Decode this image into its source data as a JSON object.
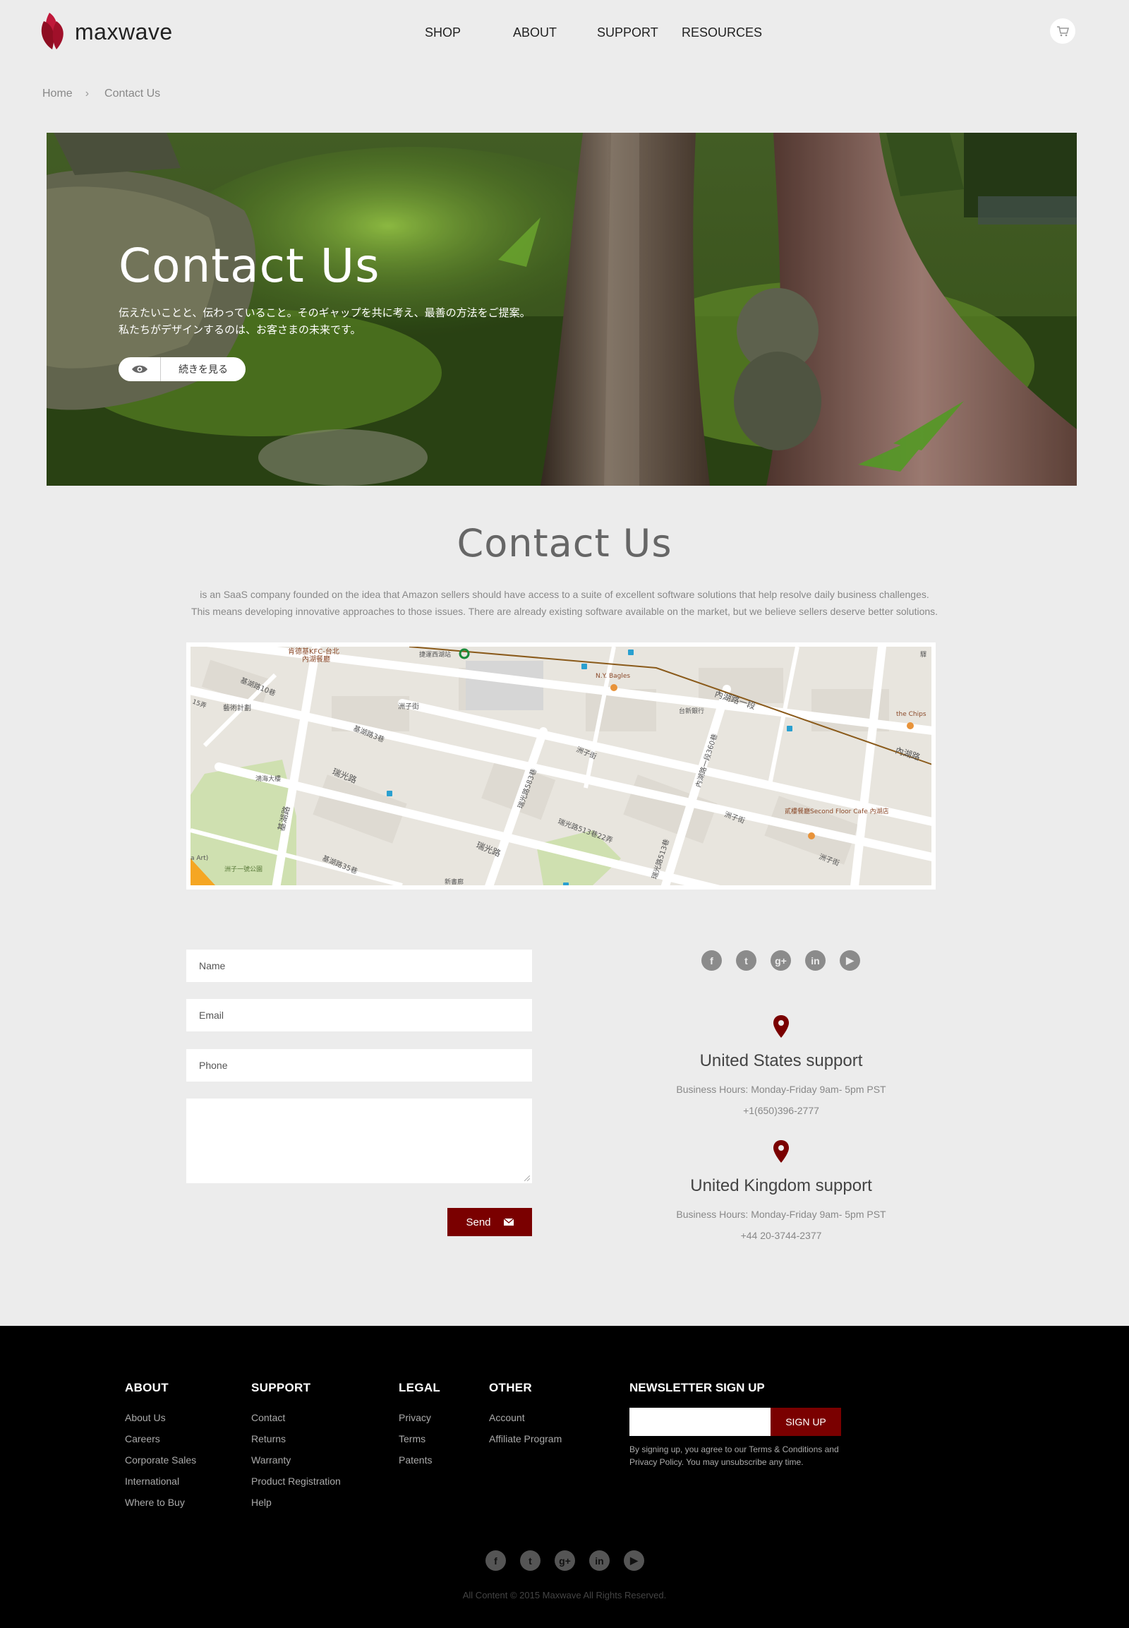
{
  "brand": {
    "name": "maxwave",
    "accent": "#7a0000"
  },
  "nav": {
    "items": [
      "SHOP",
      "ABOUT",
      "SUPPORT",
      "RESOURCES"
    ]
  },
  "header": {
    "cart_icon": "cart-icon"
  },
  "breadcrumb": {
    "items": [
      "Home",
      "Contact Us"
    ],
    "separator": "›"
  },
  "hero": {
    "title": "Contact Us",
    "description": "伝えたいことと、伝わっていること。そのギャップを共に考え、最善の方法をご提案。\n私たちがデザインするのは、お客さまの未来です。",
    "button_label": "続きを見る",
    "button_icon": "eye-icon"
  },
  "section": {
    "title": "Contact Us",
    "desc_line1": " is an SaaS company founded on the idea that Amazon sellers should have access to a suite of excellent software solutions that help resolve daily business challenges.",
    "desc_line2": "This means developing innovative approaches to those issues. There are already existing software available on the market, but we believe sellers deserve better solutions."
  },
  "map": {
    "labels": [
      "肯德基KFC-台北",
      "內湖餐廳",
      "捷運西湖站",
      "基湖路10巷",
      "藝術計劃",
      "洲子街",
      "N.Y. Bagles",
      "台新銀行",
      "內湖路一段",
      "the Chips",
      "內湖路",
      "基湖路3巷",
      "洲子街",
      "瑞光路583巷",
      "內湖路一段360巷",
      "鴻海大樓",
      "瑞光路",
      "基湖路",
      "瑞光路513巷22弄",
      "貳樓餐廳Second Floor Cafe 內湖店",
      "洲子街",
      "a Art)",
      "洲子一號公園",
      "基湖路35巷",
      "瑞光路",
      "瑞光路513巷",
      "洲子街",
      "15弄",
      "驛",
      "新書廊"
    ]
  },
  "form": {
    "name_placeholder": "Name",
    "email_placeholder": "Email",
    "phone_placeholder": "Phone",
    "message_value": "",
    "send_label": "Send"
  },
  "social": [
    "facebook-icon",
    "twitter-icon",
    "google-plus-icon",
    "linkedin-icon",
    "youtube-icon"
  ],
  "supports": [
    {
      "title": "United States support",
      "hours": "Business Hours: Monday-Friday 9am- 5pm PST",
      "phone": "+1(650)396-2777"
    },
    {
      "title": "United Kingdom support",
      "hours": "Business Hours: Monday-Friday 9am- 5pm PST",
      "phone": "+44 20-3744-2377"
    }
  ],
  "footer": {
    "about": {
      "title": "ABOUT",
      "links": [
        "About Us",
        "Careers",
        "Corporate Sales",
        "International",
        "Where to Buy"
      ]
    },
    "support": {
      "title": "SUPPORT",
      "links": [
        "Contact",
        "Returns",
        "Warranty",
        "Product Registration",
        "Help"
      ]
    },
    "legal": {
      "title": "LEGAL",
      "links": [
        "Privacy",
        "Terms",
        "Patents"
      ]
    },
    "other": {
      "title": "OTHER",
      "links": [
        "Account",
        "Affiliate Program"
      ]
    },
    "newsletter": {
      "title": "NEWSLETTER SIGN UP",
      "input_value": "",
      "button_label": "SIGN UP",
      "note": "By signing up, you agree to our Terms & Conditions and Privacy Policy. You may unsubscribe any time."
    },
    "copyright": "All Content © 2015 Maxwave All Rights Reserved."
  }
}
